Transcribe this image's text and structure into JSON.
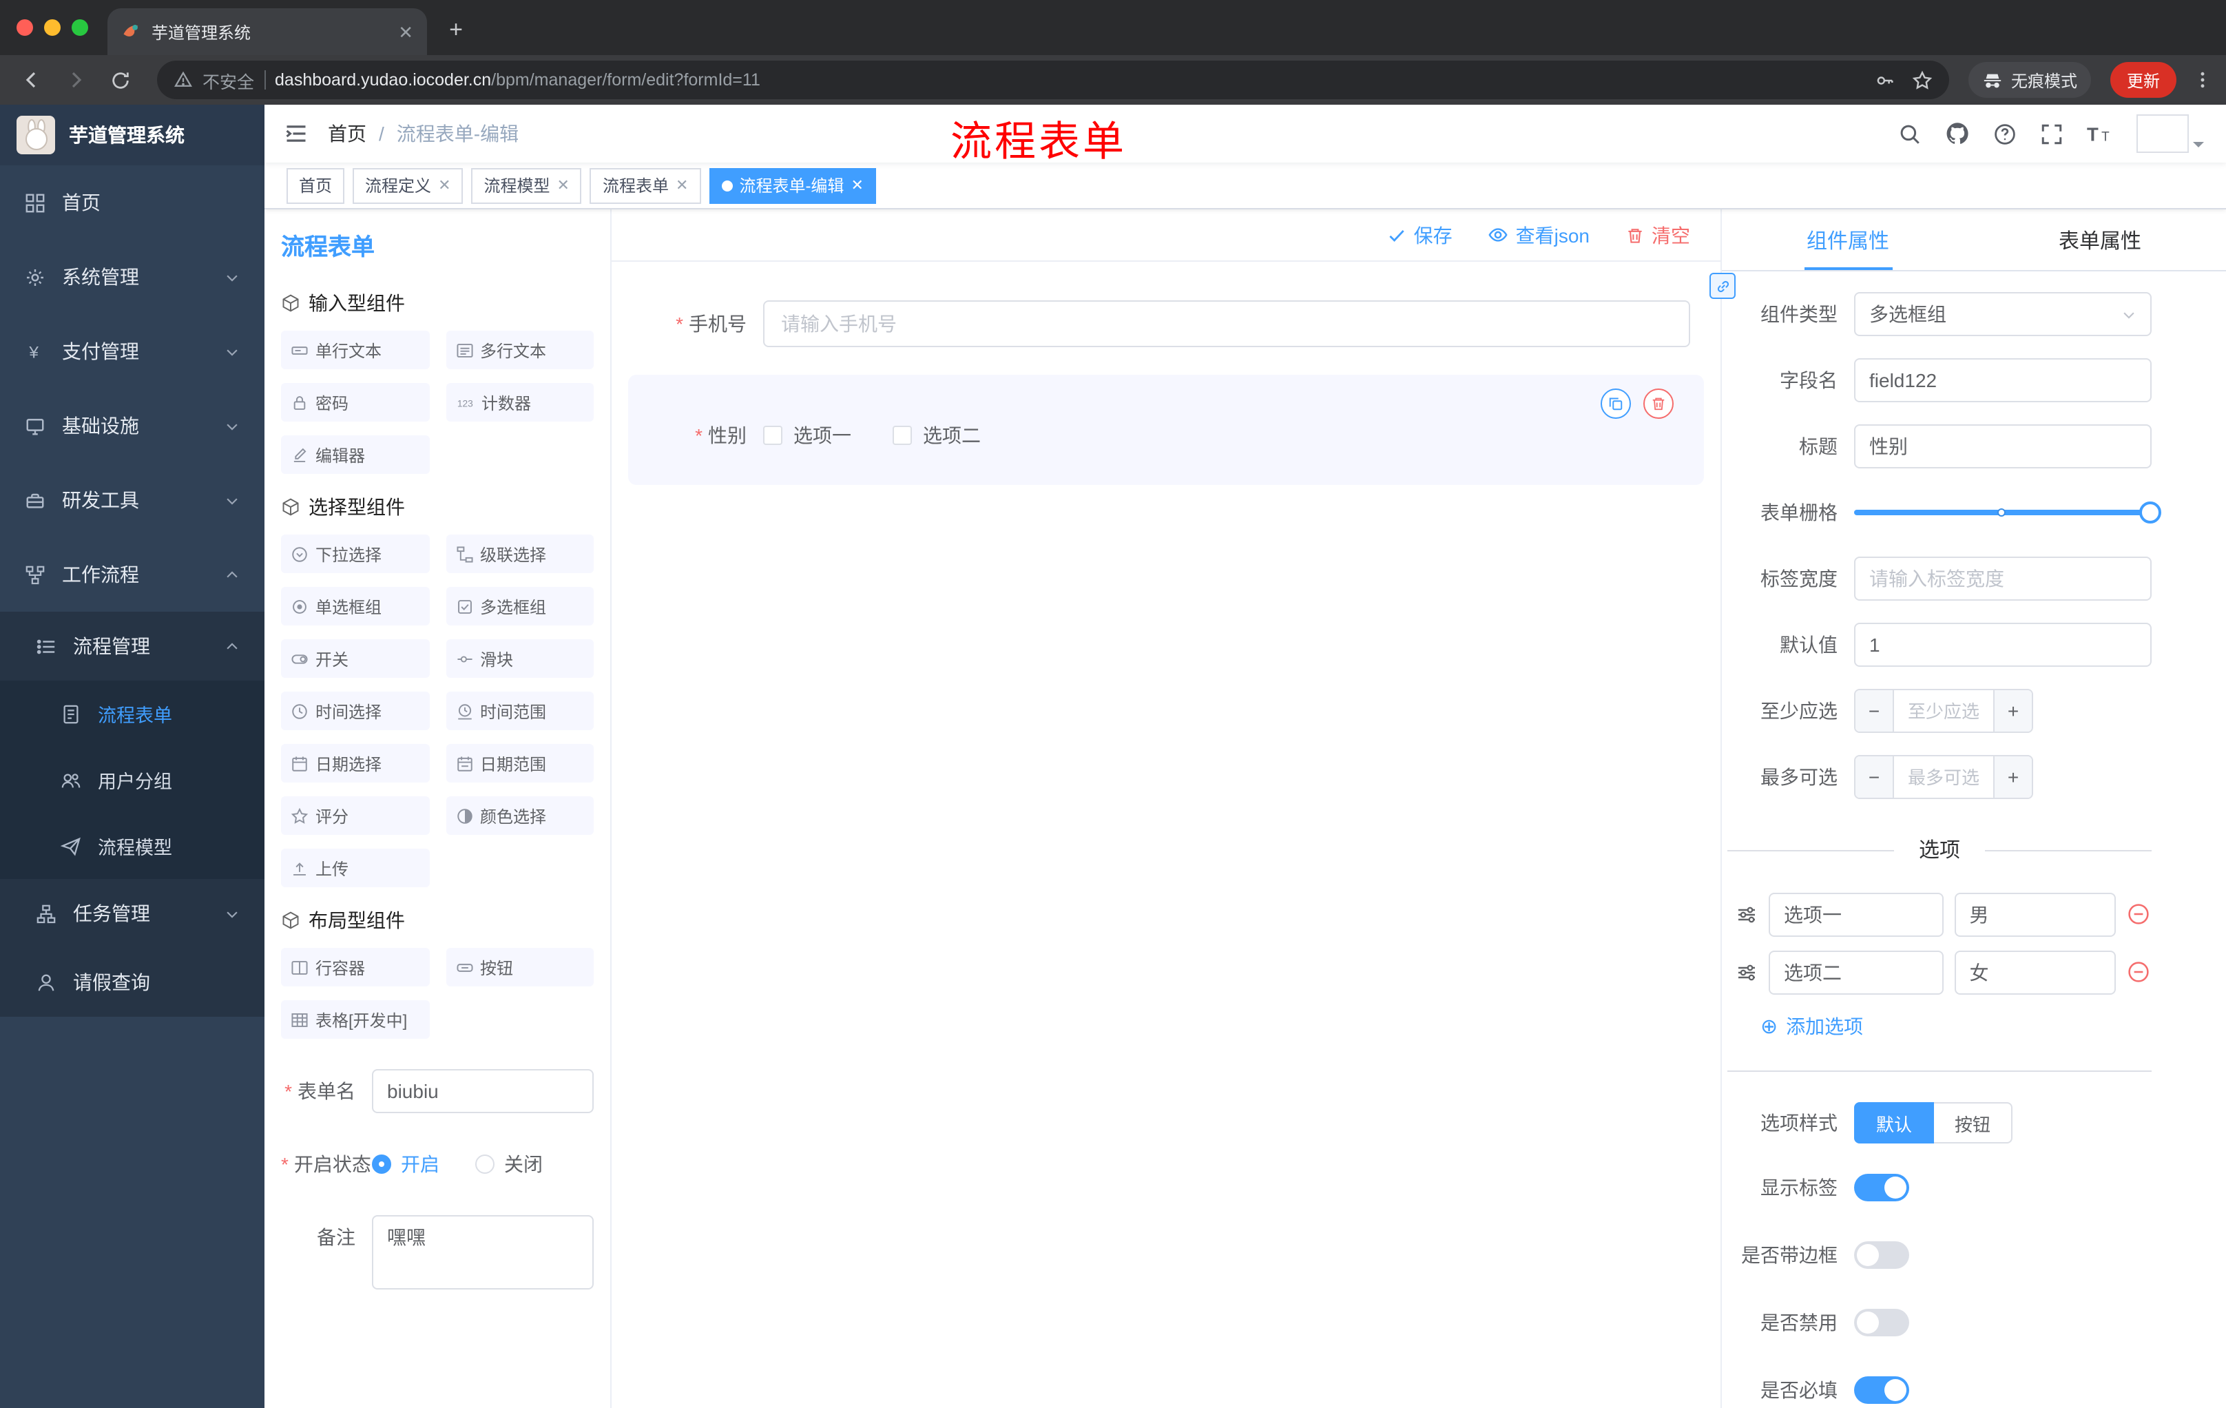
{
  "colors": {
    "accent": "#409eff",
    "danger": "#f56c6c",
    "annotation": "#fe0000",
    "sidebar_bg": "#304156"
  },
  "browser": {
    "tab_title": "芋道管理系统",
    "security_label": "不安全",
    "url_host": "dashboard.yudao.iocoder.cn",
    "url_path": "/bpm/manager/form/edit?formId=11",
    "incognito_label": "无痕模式",
    "update_label": "更新"
  },
  "sidebar": {
    "logo_title": "芋道管理系统",
    "items": {
      "home": "首页",
      "system": "系统管理",
      "payment": "支付管理",
      "infra": "基础设施",
      "devtools": "研发工具",
      "workflow": "工作流程",
      "process_mgmt": "流程管理",
      "process_form": "流程表单",
      "user_group": "用户分组",
      "process_model": "流程模型",
      "task_mgmt": "任务管理",
      "leave_query": "请假查询"
    }
  },
  "navbar": {
    "breadcrumb_home": "首页",
    "breadcrumb_sep": "/",
    "breadcrumb_current": "流程表单-编辑",
    "annotation": "流程表单"
  },
  "tags": {
    "t0": "首页",
    "t1": "流程定义",
    "t2": "流程模型",
    "t3": "流程表单",
    "t4": "流程表单-编辑"
  },
  "components": {
    "panel_title": "流程表单",
    "group_input": "输入型组件",
    "group_select": "选择型组件",
    "group_layout": "布局型组件",
    "input_items": {
      "single": "单行文本",
      "multi": "多行文本",
      "password": "密码",
      "counter": "计数器",
      "editor": "编辑器"
    },
    "select_items": {
      "select": "下拉选择",
      "cascader": "级联选择",
      "radio": "单选框组",
      "checkbox": "多选框组",
      "switch": "开关",
      "slider": "滑块",
      "time": "时间选择",
      "time_range": "时间范围",
      "date": "日期选择",
      "date_range": "日期范围",
      "rate": "评分",
      "color": "颜色选择",
      "upload": "上传"
    },
    "layout_items": {
      "row": "行容器",
      "button": "按钮",
      "table": "表格[开发中]"
    }
  },
  "panel_form": {
    "name_label": "表单名",
    "name_value": "biubiu",
    "status_label": "开启状态",
    "status_on": "开启",
    "status_off": "关闭",
    "remark_label": "备注",
    "remark_value": "嘿嘿"
  },
  "canvas": {
    "save": "保存",
    "view_json": "查看json",
    "clear": "清空",
    "phone_label": "手机号",
    "phone_placeholder": "请输入手机号",
    "gender_label": "性别",
    "gender_opt1": "选项一",
    "gender_opt2": "选项二"
  },
  "props": {
    "tab_component": "组件属性",
    "tab_form": "表单属性",
    "type_label": "组件类型",
    "type_value": "多选框组",
    "field_label": "字段名",
    "field_value": "field122",
    "title_label": "标题",
    "title_value": "性别",
    "grid_label": "表单栅格",
    "label_width_label": "标签宽度",
    "label_width_placeholder": "请输入标签宽度",
    "default_label": "默认值",
    "default_value": "1",
    "min_label": "至少应选",
    "min_placeholder": "至少应选",
    "max_label": "最多可选",
    "max_placeholder": "最多可选",
    "options_title": "选项",
    "opt1_label": "选项一",
    "opt1_value": "男",
    "opt2_label": "选项二",
    "opt2_value": "女",
    "add_option": "添加选项",
    "style_label": "选项样式",
    "style_default": "默认",
    "style_button": "按钮",
    "show_label": "显示标签",
    "border_label": "是否带边框",
    "disabled_label": "是否禁用",
    "required_label": "是否必填"
  }
}
